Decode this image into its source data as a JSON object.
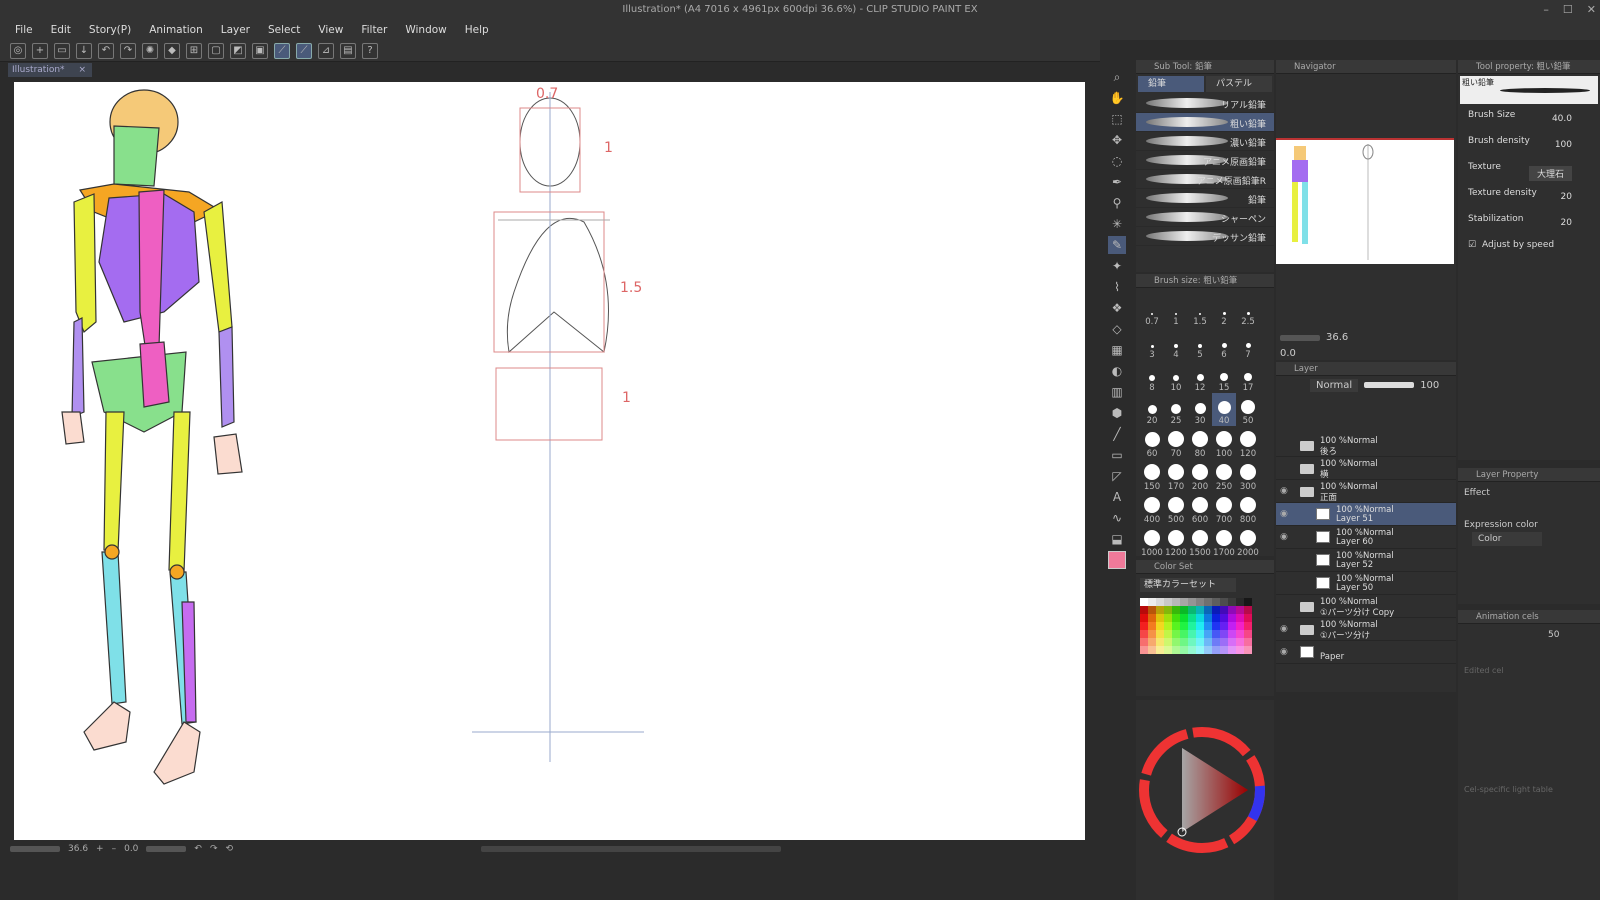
{
  "window": {
    "title": "Illustration* (A4 7016 x 4961px 600dpi 36.6%) - CLIP STUDIO PAINT EX",
    "controls": [
      "–",
      "☐",
      "✕"
    ]
  },
  "menu": [
    "File",
    "Edit",
    "Story(P)",
    "Animation",
    "Layer",
    "Select",
    "View",
    "Filter",
    "Window",
    "Help"
  ],
  "document_tab": {
    "label": "Illustration*",
    "close": "×"
  },
  "canvas_labels": {
    "head": "0.7",
    "ratio_1a": "1",
    "ratio_15": "1.5",
    "ratio_1b": "1"
  },
  "status": {
    "zoom": "36.6",
    "angle": "0.0"
  },
  "subtool": {
    "title": "Sub Tool: 鉛筆",
    "tabs": [
      "鉛筆",
      "パステル"
    ],
    "brushes": [
      "リアル鉛筆",
      "粗い鉛筆",
      "濃い鉛筆",
      "アニメ原画鉛筆",
      "アニメ原画鉛筆R",
      "鉛筆",
      "シャーペン",
      "デッサン鉛筆"
    ],
    "selected_index": 1
  },
  "brush_size": {
    "title": "Brush size: 粗い鉛筆",
    "sizes": [
      "0.7",
      "1",
      "1.5",
      "2",
      "2.5",
      "3",
      "4",
      "5",
      "6",
      "7",
      "8",
      "10",
      "12",
      "15",
      "17",
      "20",
      "25",
      "30",
      "40",
      "50",
      "60",
      "70",
      "80",
      "100",
      "120",
      "150",
      "170",
      "200",
      "250",
      "300",
      "400",
      "500",
      "600",
      "700",
      "800",
      "1000",
      "1200",
      "1500",
      "1700",
      "2000"
    ],
    "selected": "40"
  },
  "color_set": {
    "title": "Color Set",
    "preset": "標準カラーセット"
  },
  "color_wheel": {
    "main_color": "#f07a9a"
  },
  "navigator": {
    "title": "Navigator",
    "zoom": "36.6",
    "angle": "0.0"
  },
  "layer": {
    "title": "Layer",
    "blend": "Normal",
    "opacity": "100",
    "rows": [
      {
        "line1": "100 %Normal",
        "line2": "後ろ",
        "type": "folder",
        "visible": false,
        "selected": false
      },
      {
        "line1": "100 %Normal",
        "line2": "横",
        "type": "folder",
        "visible": false,
        "selected": false
      },
      {
        "line1": "100 %Normal",
        "line2": "正面",
        "type": "folder",
        "visible": true,
        "selected": false
      },
      {
        "line1": "100 %Normal",
        "line2": "Layer 51",
        "type": "layer",
        "visible": true,
        "selected": true
      },
      {
        "line1": "100 %Normal",
        "line2": "Layer 60",
        "type": "layer",
        "visible": true,
        "selected": false
      },
      {
        "line1": "100 %Normal",
        "line2": "Layer 52",
        "type": "layer",
        "visible": false,
        "selected": false
      },
      {
        "line1": "100 %Normal",
        "line2": "Layer 50",
        "type": "layer",
        "visible": false,
        "selected": false
      },
      {
        "line1": "100 %Normal",
        "line2": "①パーツ分け Copy",
        "type": "folder",
        "visible": false,
        "selected": false
      },
      {
        "line1": "100 %Normal",
        "line2": "①パーツ分け",
        "type": "folder",
        "visible": true,
        "selected": false
      },
      {
        "line1": "",
        "line2": "Paper",
        "type": "paper",
        "visible": true,
        "selected": false
      }
    ]
  },
  "tool_property": {
    "title": "Tool property: 粗い鉛筆",
    "brush_name": "粗い鉛筆",
    "brush_size_label": "Brush Size",
    "brush_size": "40.0",
    "brush_density_label": "Brush density",
    "brush_density": "100",
    "texture_label": "Texture",
    "texture": "大理石",
    "texture_density_label": "Texture density",
    "texture_density": "20",
    "stabilization_label": "Stabilization",
    "stabilization": "20",
    "adjust_label": "Adjust by speed"
  },
  "layer_property": {
    "title": "Layer Property",
    "effect_label": "Effect",
    "expression_label": "Expression color",
    "expression_value": "Color"
  },
  "animation_cels": {
    "title": "Animation cels",
    "value": "50",
    "edited": "Edited cel",
    "light_table": "Cel-specific light table"
  }
}
